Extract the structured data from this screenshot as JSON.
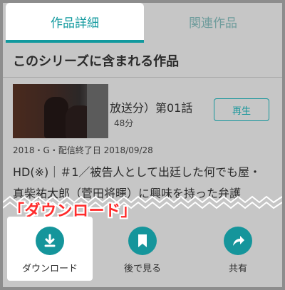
{
  "tabs": [
    {
      "label": "作品詳細",
      "active": true
    },
    {
      "label": "関連作品",
      "active": false
    }
  ],
  "section_title": "このシリーズに含まれる作品",
  "episode": {
    "title": "放送分）第01話",
    "duration": "48分",
    "play_label": "再生"
  },
  "meta": "2018・G・配信終了日 2018/09/28",
  "description_lines": [
    "HD(※)｜＃1／被告人として出廷した何でも屋・",
    "真柴祐太郎（菅田将暉）に興味を持った弁護"
  ],
  "annotation": "「ダウンロード」",
  "actions": [
    {
      "label": "ダウンロード",
      "icon": "download-icon"
    },
    {
      "label": "後で見る",
      "icon": "bookmark-icon"
    },
    {
      "label": "共有",
      "icon": "share-icon"
    }
  ],
  "colors": {
    "accent": "#15959b",
    "annotation": "#ff2a2a",
    "overlay_bg": "#c6c6c6"
  }
}
